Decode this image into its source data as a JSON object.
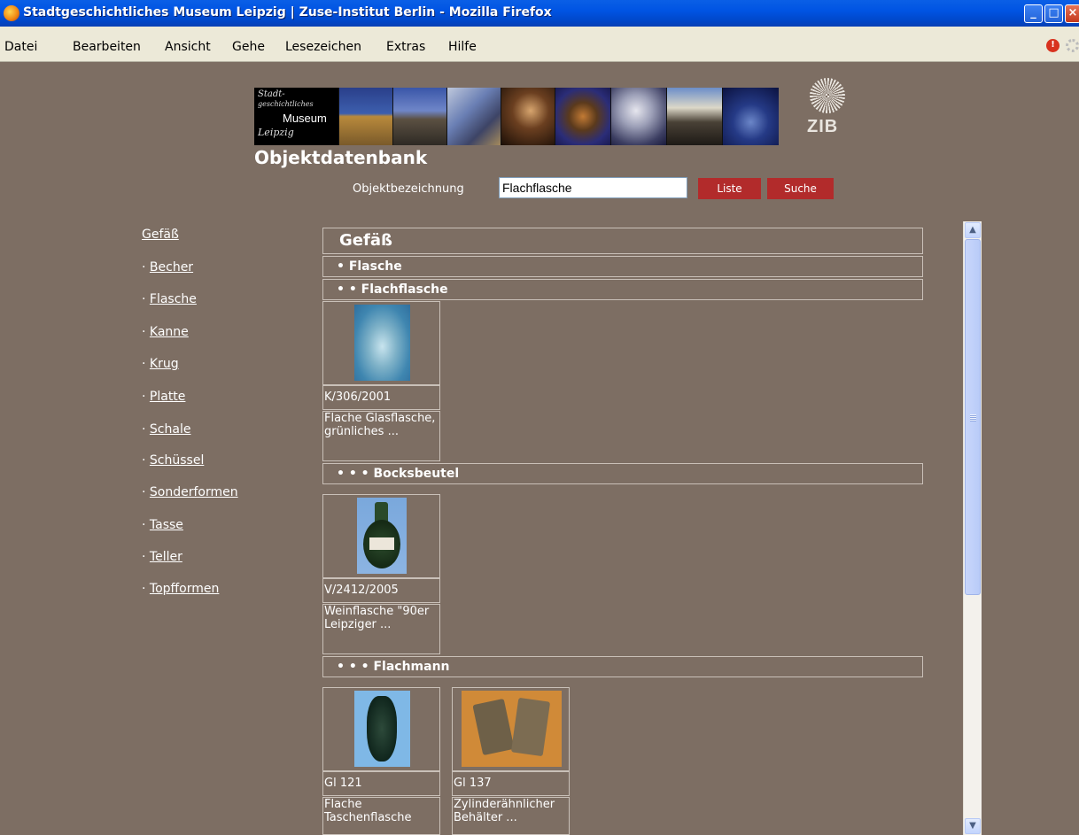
{
  "window": {
    "title": "Stadtgeschichtliches Museum Leipzig | Zuse-Institut Berlin - Mozilla Firefox"
  },
  "menu": {
    "items": [
      "Datei",
      "Bearbeiten",
      "Ansicht",
      "Gehe",
      "Lesezeichen",
      "Extras",
      "Hilfe"
    ]
  },
  "banner": {
    "logo_line1": "Stadt-",
    "logo_line2": "geschichtliches",
    "logo_museum": "Museum",
    "logo_leipzig": "Leipzig",
    "zib_text": "ZIB"
  },
  "page": {
    "title": "Objektdatenbank"
  },
  "search": {
    "label": "Objektbezeichnung",
    "value": "Flachflasche",
    "liste_button": "Liste",
    "suche_button": "Suche"
  },
  "nav": {
    "heading": "Gefäß",
    "items": [
      "Becher",
      "Flasche",
      "Kanne",
      "Krug",
      "Platte",
      "Schale",
      "Schüssel",
      "Sonderformen",
      "Tasse",
      "Teller",
      "Topfformen"
    ]
  },
  "content": {
    "h1": "Gefäß",
    "h2": "• Flasche",
    "h3": "• • Flachflasche",
    "section1": {
      "items": [
        {
          "id": "K/306/2001",
          "desc": "Flache Glasflasche, grünliches ..."
        }
      ]
    },
    "h4": "• • • Bocksbeutel",
    "section2": {
      "items": [
        {
          "id": "V/2412/2005",
          "desc": "Weinflasche \"90er Leipziger ..."
        }
      ]
    },
    "h5": "• • • Flachmann",
    "section3": {
      "items": [
        {
          "id": "Gl 121",
          "desc": "Flache Taschenflasche"
        },
        {
          "id": "Gl 137",
          "desc": "Zylinderähnlicher Behälter ..."
        }
      ]
    }
  },
  "colors": {
    "page_background": "#7d6e63",
    "button_red": "#b22b2b",
    "titlebar_blue": "#0054e3"
  }
}
